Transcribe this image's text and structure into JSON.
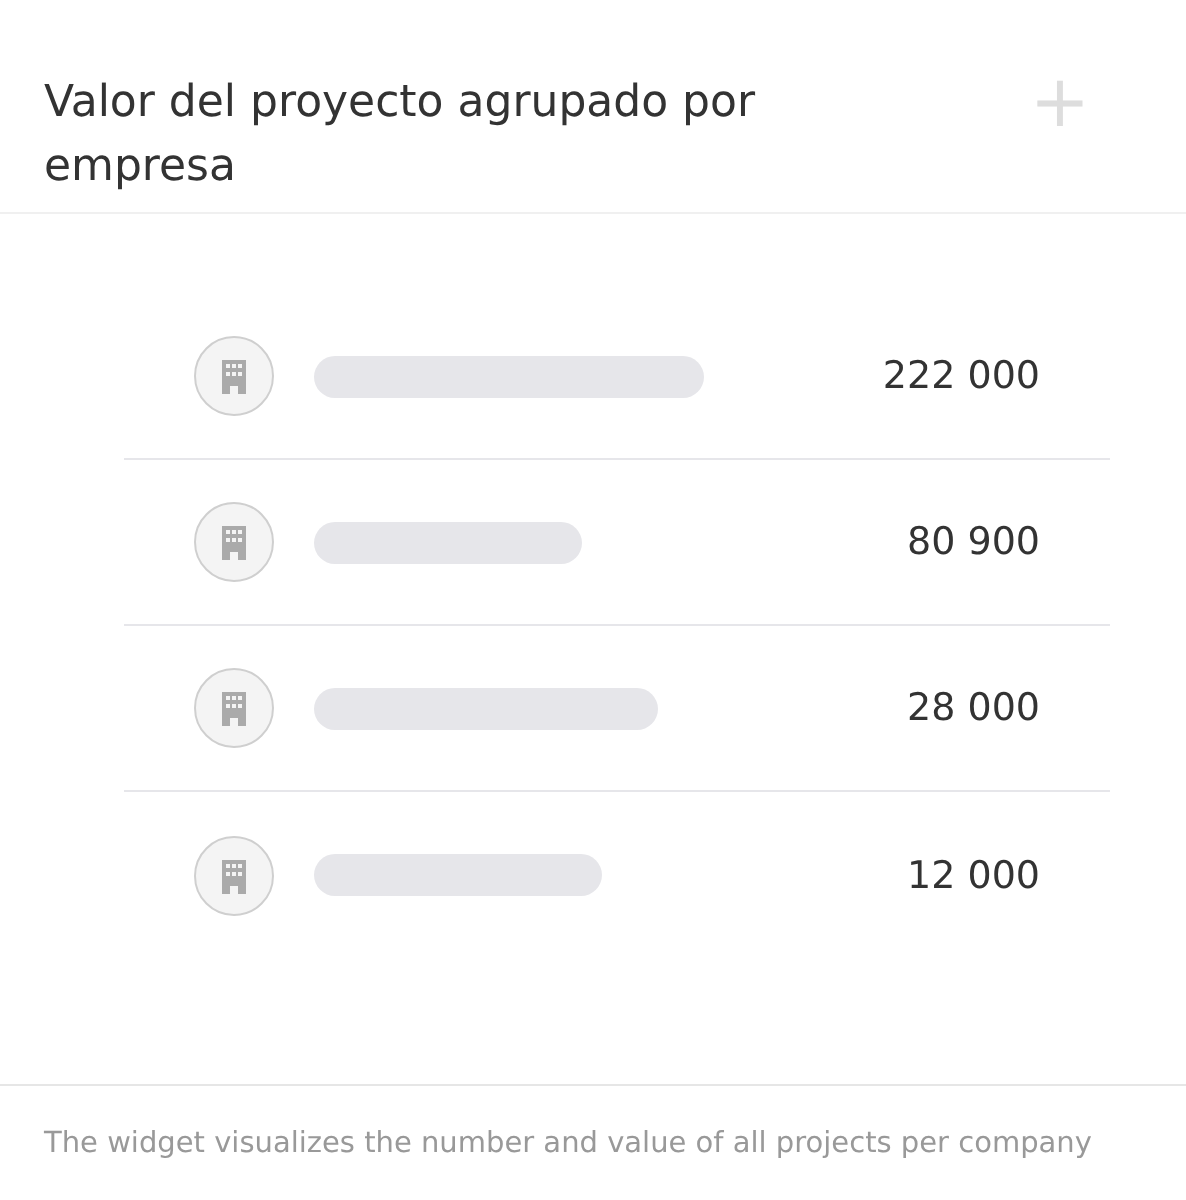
{
  "widget": {
    "title": "Valor del proyecto agrupado por empresa",
    "add_button": "+"
  },
  "companies": [
    {
      "value": "222 000"
    },
    {
      "value": "80 900"
    },
    {
      "value": "28 000"
    },
    {
      "value": "12 000"
    }
  ],
  "footer": "The widget visualizes the number and value of all projects per company"
}
